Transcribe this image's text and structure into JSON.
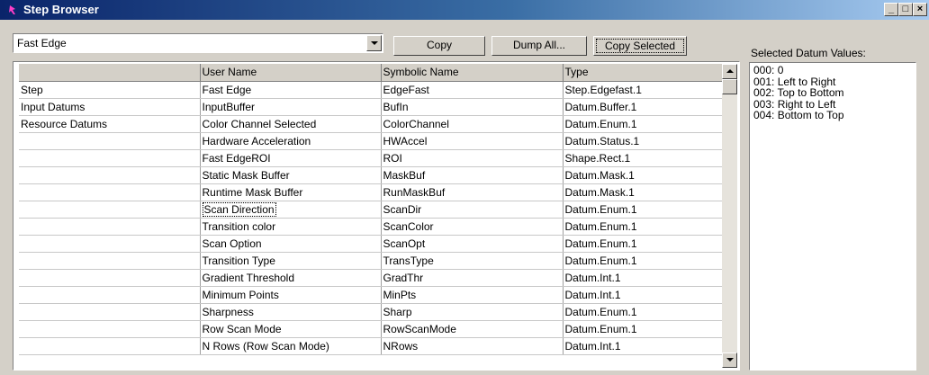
{
  "window": {
    "title": "Step Browser",
    "controls": [
      "_",
      "□",
      "×"
    ]
  },
  "toolbar": {
    "step_select": "Fast Edge",
    "copy_label": "Copy",
    "dump_label": "Dump All...",
    "copy_selected_label": "Copy Selected"
  },
  "grid": {
    "headers": [
      "",
      "User Name",
      "Symbolic Name",
      "Type"
    ],
    "rows": [
      [
        "Step",
        "Fast Edge",
        "EdgeFast",
        "Step.Edgefast.1"
      ],
      [
        "Input Datums",
        "InputBuffer",
        "BufIn",
        "Datum.Buffer.1"
      ],
      [
        "Resource Datums",
        "Color Channel Selected",
        "ColorChannel",
        "Datum.Enum.1"
      ],
      [
        "",
        "Hardware Acceleration",
        "HWAccel",
        "Datum.Status.1"
      ],
      [
        "",
        "Fast EdgeROI",
        "ROI",
        "Shape.Rect.1"
      ],
      [
        "",
        "Static Mask Buffer",
        "MaskBuf",
        "Datum.Mask.1"
      ],
      [
        "",
        "Runtime Mask Buffer",
        "RunMaskBuf",
        "Datum.Mask.1"
      ],
      [
        "",
        "Scan Direction",
        "ScanDir",
        "Datum.Enum.1"
      ],
      [
        "",
        "Transition color",
        "ScanColor",
        "Datum.Enum.1"
      ],
      [
        "",
        "Scan Option",
        "ScanOpt",
        "Datum.Enum.1"
      ],
      [
        "",
        "Transition Type",
        "TransType",
        "Datum.Enum.1"
      ],
      [
        "",
        "Gradient Threshold",
        "GradThr",
        "Datum.Int.1"
      ],
      [
        "",
        "Minimum Points",
        "MinPts",
        "Datum.Int.1"
      ],
      [
        "",
        "Sharpness",
        "Sharp",
        "Datum.Enum.1"
      ],
      [
        "",
        "Row Scan Mode",
        "RowScanMode",
        "Datum.Enum.1"
      ],
      [
        "",
        "N Rows (Row Scan Mode)",
        "NRows",
        "Datum.Int.1"
      ]
    ]
  },
  "values_panel": {
    "label": "Selected Datum Values:",
    "items": [
      "000: 0",
      "001: Left to Right",
      "002: Top to Bottom",
      "003: Right to Left",
      "004: Bottom to Top"
    ]
  }
}
